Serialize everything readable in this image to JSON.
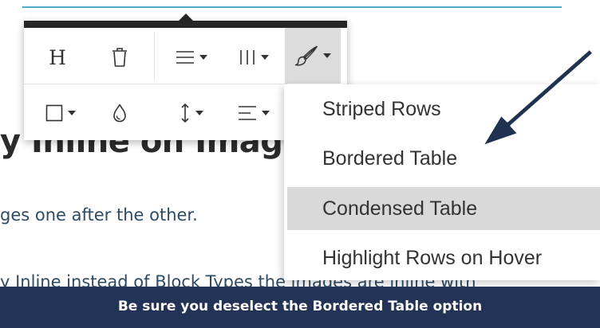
{
  "document": {
    "heading_fragment": "y Inline on Imag",
    "subtext_fragment": "ges one after the other.",
    "partial_line": "y Inline instead of Block Types the images are inline with"
  },
  "toolbar": {
    "buttons": [
      {
        "name": "heading",
        "icon": "heading-icon",
        "label": "H"
      },
      {
        "name": "delete-table",
        "icon": "trash-icon"
      },
      {
        "name": "row-options",
        "icon": "rows-icon",
        "has_dropdown": true
      },
      {
        "name": "column-options",
        "icon": "columns-icon",
        "has_dropdown": true
      },
      {
        "name": "table-style",
        "icon": "paintbrush-icon",
        "has_dropdown": true,
        "active": true
      },
      {
        "name": "cell-border",
        "icon": "square-border-icon",
        "has_dropdown": true
      },
      {
        "name": "cell-background",
        "icon": "droplet-icon"
      },
      {
        "name": "vertical-align",
        "icon": "vertical-align-icon",
        "has_dropdown": true
      },
      {
        "name": "horizontal-align",
        "icon": "align-left-icon",
        "has_dropdown": true
      }
    ]
  },
  "style_menu": {
    "items": [
      {
        "label": "Striped Rows",
        "highlighted": false
      },
      {
        "label": "Bordered Table",
        "highlighted": false
      },
      {
        "label": "Condensed Table",
        "highlighted": true
      },
      {
        "label": "Highlight Rows on Hover",
        "highlighted": false
      }
    ]
  },
  "annotation": {
    "arrow_color": "#1f3250",
    "arrow_target": "Bordered Table"
  },
  "caption": {
    "text": "Be sure you deselect the Bordered Table option"
  },
  "colors": {
    "toolbar_top_bar": "#262626",
    "active_button_bg": "#dcdcdc",
    "menu_highlight_bg": "#d9d9d9",
    "caption_bg": "#233355",
    "link_text": "#2d4a63",
    "accent_line": "#4ea9c4"
  }
}
